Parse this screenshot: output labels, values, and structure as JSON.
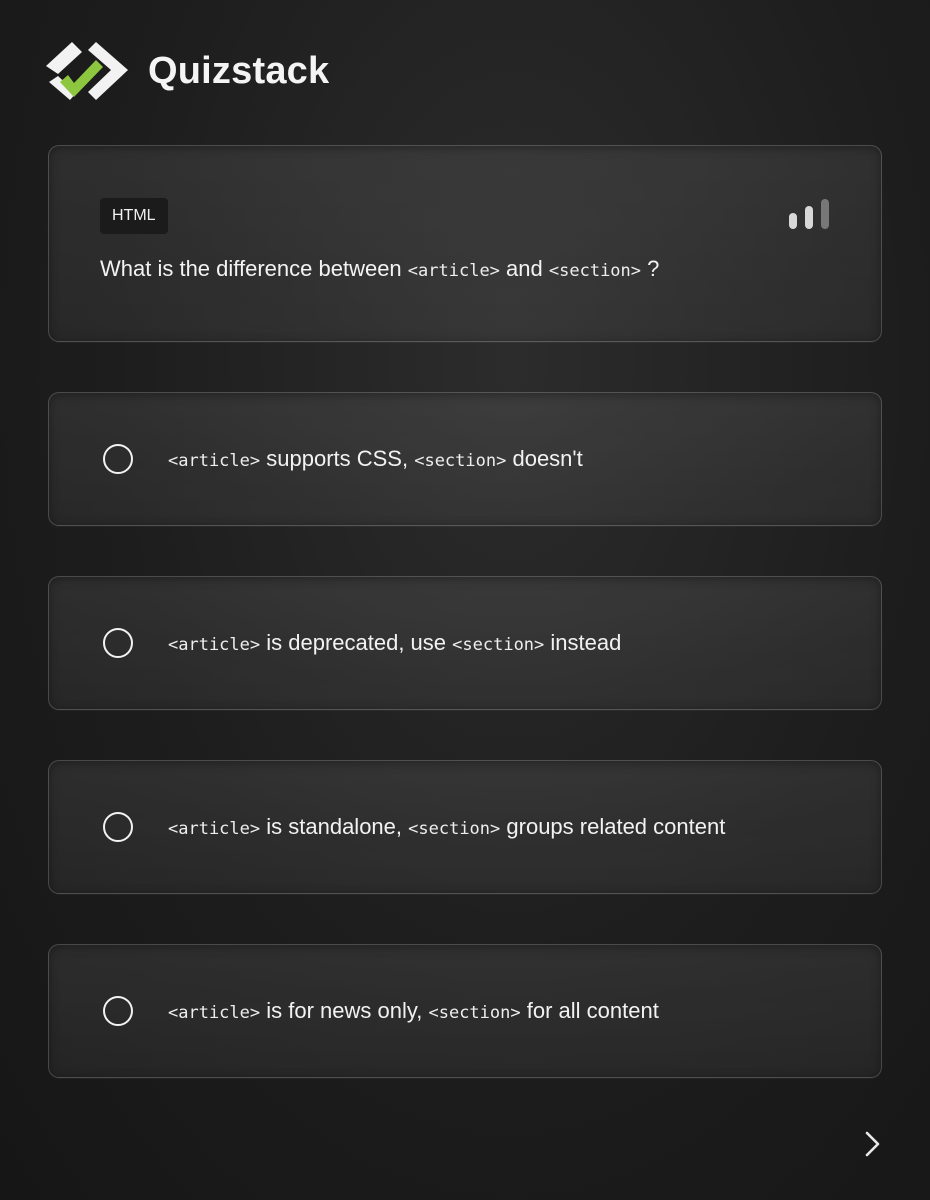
{
  "app": {
    "name": "Quizstack",
    "logo_icon": "check-chevrons-icon"
  },
  "question": {
    "tag": "HTML",
    "difficulty_icon": "bar-chart-icon",
    "text_before": "What is the difference between",
    "code1": "<article>",
    "text_middle": "and",
    "code2": "<section>",
    "text_after": "?"
  },
  "options": [
    {
      "code1": "<article>",
      "text1": "supports CSS,",
      "code2": "<section>",
      "text2": "doesn't"
    },
    {
      "code1": "<article>",
      "text1": "is deprecated, use",
      "code2": "<section>",
      "text2": "instead"
    },
    {
      "code1": "<article>",
      "text1": "is standalone,",
      "code2": "<section>",
      "text2": "groups related content"
    },
    {
      "code1": "<article>",
      "text1": "is for news only,",
      "code2": "<section>",
      "text2": "for all content"
    }
  ],
  "navigation": {
    "next_icon": "chevron-right-icon"
  },
  "colors": {
    "accent": "#8dc63f",
    "background": "#1d1d1d",
    "card_border": "#4a4a4a"
  }
}
